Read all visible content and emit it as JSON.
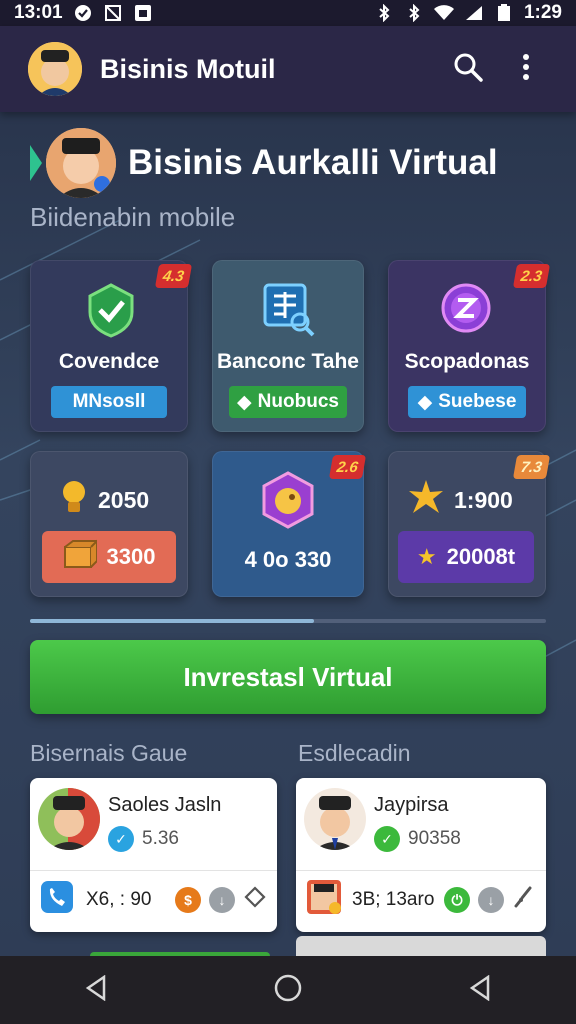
{
  "status_bar": {
    "time_left": "13:01",
    "time_right": "1:29",
    "icons": [
      "notification-icon",
      "no-sim-icon",
      "app-icon",
      "bluetooth-icon",
      "bluetooth-icon",
      "wifi-icon",
      "signal-icon",
      "battery-icon"
    ]
  },
  "app_bar": {
    "title": "Bisinis Motuil",
    "icons": [
      "avatar",
      "search-icon",
      "more-vert-icon"
    ]
  },
  "hero": {
    "title": "Bisinis Aurkalli Virtual",
    "subtitle": "Biidenabin mobile"
  },
  "tiles": [
    {
      "label": "Covendce",
      "pill": "MNsosll",
      "badge": "4.3",
      "icon": "shield-check-icon",
      "bg": "#333a5c",
      "pill_color": "#2f92d6"
    },
    {
      "label": "Banconc Tahe",
      "pill": "Nuobucs",
      "badge": "",
      "icon": "table-search-icon",
      "bg": "#3e5a6e",
      "pill_color": "#2fa042"
    },
    {
      "label": "Scopadonas",
      "pill": "Suebese",
      "badge": "2.3",
      "icon": "z-coin-icon",
      "bg": "#3b3463",
      "pill_color": "#2f92d6"
    }
  ],
  "stats": {
    "coins": "2050",
    "box_value": "3300",
    "center_value": "4 0o 330",
    "center_badge": "2.6",
    "star_value": "1:900",
    "star_box": "20008t",
    "star_badge": "7.3"
  },
  "progress": 0.55,
  "invest_button": "Invrestasl Virtual",
  "sections": {
    "left": "Bisernais Gaue",
    "right": "Esdlecadin"
  },
  "cards": [
    {
      "name": "Saoles Jasln",
      "meta": "5.36",
      "foot_text": "X6, : 90",
      "meta_icon": "check-badge-icon"
    },
    {
      "name": "Jaypirsa",
      "meta": "90358",
      "foot_text": "3B; 13aro",
      "meta_icon": "check-circle-icon"
    }
  ],
  "nav": [
    "back-icon",
    "home-icon",
    "recents-icon"
  ],
  "colors": {
    "accent_green": "#3cb93c",
    "app_bar": "#2b2747",
    "badge_red": "#d52e2e"
  }
}
